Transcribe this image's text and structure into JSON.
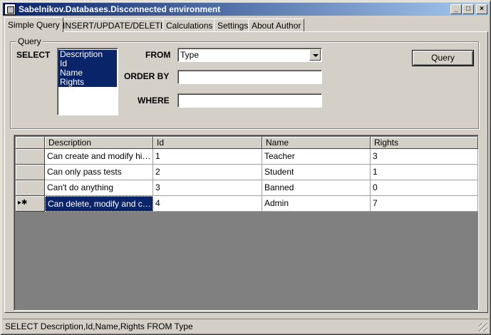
{
  "window": {
    "title": "Sabelnikov.Databases.Disconnected environment"
  },
  "titlebar_buttons": {
    "minimize": "_",
    "maximize": "□",
    "close": "×"
  },
  "tabs": [
    {
      "label": "Simple Query",
      "active": true
    },
    {
      "label": "INSERT/UPDATE/DELETE"
    },
    {
      "label": "Calculations"
    },
    {
      "label": "Settings"
    },
    {
      "label": "About Author"
    }
  ],
  "query": {
    "group_label": "Query",
    "select_label": "SELECT",
    "select_items": [
      "Description",
      "Id",
      "Name",
      "Rights"
    ],
    "from_label": "FROM",
    "from_value": "Type",
    "orderby_label": "ORDER BY",
    "orderby_value": "",
    "where_label": "WHERE",
    "where_value": "",
    "button_label": "Query"
  },
  "grid": {
    "columns": [
      "Description",
      "Id",
      "Name",
      "Rights"
    ],
    "rows": [
      {
        "marker": "",
        "cells": [
          "Can create and modify his o...",
          "1",
          "Teacher",
          "3"
        ]
      },
      {
        "marker": "",
        "cells": [
          "Can only pass tests",
          "2",
          "Student",
          "1"
        ]
      },
      {
        "marker": "",
        "cells": [
          "Can't do anything",
          "3",
          "Banned",
          "0"
        ]
      },
      {
        "marker": "▸✱",
        "cells": [
          "Can delete, modify and creat...",
          "4",
          "Admin",
          "7"
        ]
      }
    ]
  },
  "status": {
    "text": "SELECT Description,Id,Name,Rights FROM Type"
  },
  "colors": {
    "highlight": "#0a246a",
    "face": "#d4d0c8",
    "grid_bg": "#808080"
  }
}
